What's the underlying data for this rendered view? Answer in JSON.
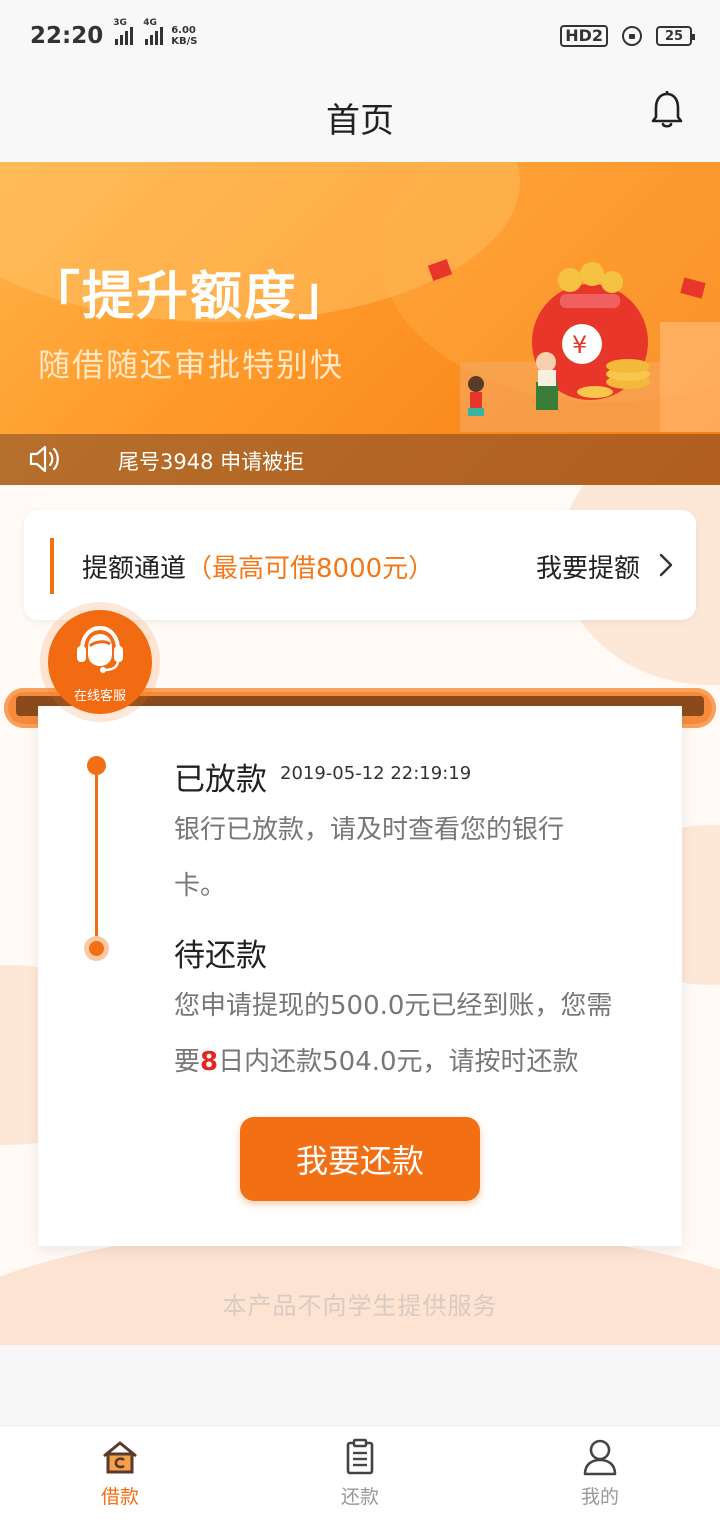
{
  "status_bar": {
    "time": "22:20",
    "sim1": "3G",
    "sim2": "4G",
    "net_speed": "6.00",
    "net_unit": "KB/S",
    "hd_label": "HD2",
    "battery": "25"
  },
  "nav": {
    "title": "首页"
  },
  "banner": {
    "title": "「提升额度」",
    "subtitle": "随借随还审批特别快",
    "ticker": "尾号3948 申请被拒"
  },
  "quota": {
    "label": "提额通道",
    "highlight": "（最高可借8000元）",
    "action": "我要提额"
  },
  "service": {
    "label": "在线客服"
  },
  "timeline": {
    "step1": {
      "title": "已放款",
      "time": "2019-05-12 22:19:19",
      "desc": "银行已放款，请及时查看您的银行卡。"
    },
    "step2": {
      "title": "待还款",
      "desc_a": "您申请提现的500.0元已经到账，您需要",
      "days": "8",
      "desc_b": "日内还款504.0元，请按时还款"
    }
  },
  "repay_button": "我要还款",
  "disclaimer": "本产品不向学生提供服务",
  "tabs": [
    {
      "label": "借款",
      "icon": "home-loan-icon",
      "active": true
    },
    {
      "label": "还款",
      "icon": "clipboard-icon",
      "active": false
    },
    {
      "label": "我的",
      "icon": "user-icon",
      "active": false
    }
  ],
  "colors": {
    "accent": "#f36f14",
    "highlight": "#f6761a",
    "alert": "#e3261e"
  }
}
